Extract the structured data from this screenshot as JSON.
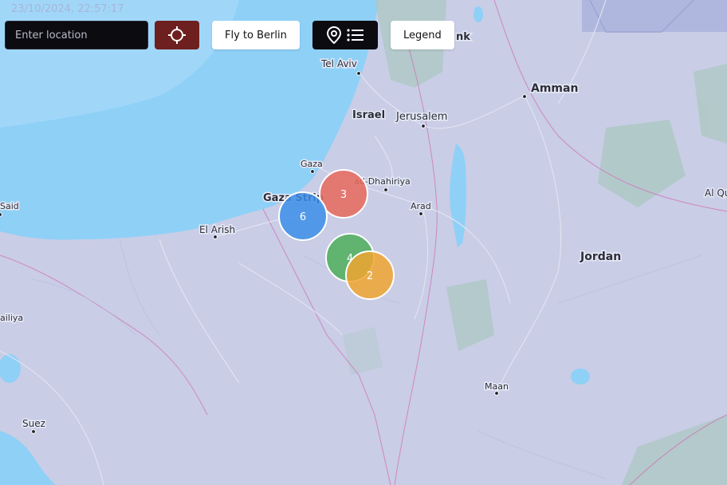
{
  "timestamp": "23/10/2024, 22:57:17",
  "toolbar": {
    "location_placeholder": "Enter location",
    "locate_icon": "crosshair-icon",
    "fly_label": "Fly to Berlin",
    "poi_icons": [
      "map-pin-icon",
      "list-icon"
    ],
    "legend_label": "Legend",
    "locate_color": "#6e1f1f"
  },
  "map": {
    "places": [
      {
        "name": "Tel Aviv",
        "dot": true
      },
      {
        "name": "Israel",
        "dot": false
      },
      {
        "name": "Jerusalem",
        "dot": true
      },
      {
        "name": "Amman",
        "dot": true
      },
      {
        "name": "Gaza",
        "dot": true
      },
      {
        "name": "ad-Dhahiriya",
        "dot": true
      },
      {
        "name": "Gaza Strip",
        "dot": false
      },
      {
        "name": "Said",
        "dot": true
      },
      {
        "name": "Arad",
        "dot": true
      },
      {
        "name": "El Arish",
        "dot": true
      },
      {
        "name": "Jordan",
        "dot": false
      },
      {
        "name": "Al Qu",
        "dot": false
      },
      {
        "name": "ailiya",
        "dot": false
      },
      {
        "name": "Maan",
        "dot": true
      },
      {
        "name": "Suez",
        "dot": true
      },
      {
        "name": "nk",
        "dot": false
      }
    ],
    "clusters": [
      {
        "count": "3",
        "color": "#e8695c"
      },
      {
        "count": "6",
        "color": "#3d8ee8"
      },
      {
        "count": "4",
        "color": "#4fae5b"
      },
      {
        "count": "2",
        "color": "#f0a430"
      }
    ],
    "colors": {
      "sea": "#8fd0f7",
      "land": "#c9cde6",
      "green": "#a9c8bf"
    }
  }
}
